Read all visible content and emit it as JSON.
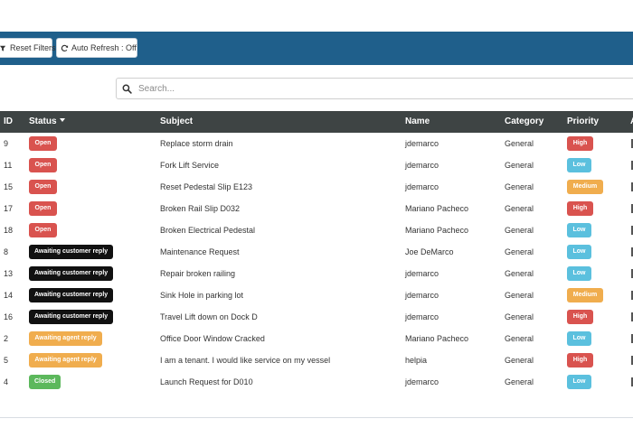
{
  "toolbar": {
    "reset_label": "Reset Filters",
    "auto_refresh_label": "Auto Refresh : Off"
  },
  "search": {
    "placeholder": "Search...",
    "value": ""
  },
  "table": {
    "headers": {
      "id": "ID",
      "status": "Status",
      "subject": "Subject",
      "name": "Name",
      "category": "Category",
      "priority": "Priority"
    },
    "rows": [
      {
        "id": "9",
        "status": "Open",
        "subject": "Replace storm drain",
        "name": "jdemarco",
        "category": "General",
        "priority": "High"
      },
      {
        "id": "11",
        "status": "Open",
        "subject": "Fork Lift Service",
        "name": "jdemarco",
        "category": "General",
        "priority": "Low"
      },
      {
        "id": "15",
        "status": "Open",
        "subject": "Reset Pedestal Slip E123",
        "name": "jdemarco",
        "category": "General",
        "priority": "Medium"
      },
      {
        "id": "17",
        "status": "Open",
        "subject": "Broken Rail Slip D032",
        "name": "Mariano Pacheco",
        "category": "General",
        "priority": "High"
      },
      {
        "id": "18",
        "status": "Open",
        "subject": "Broken Electrical Pedestal",
        "name": "Mariano Pacheco",
        "category": "General",
        "priority": "Low"
      },
      {
        "id": "8",
        "status": "Awaiting customer reply",
        "subject": "Maintenance Request",
        "name": "Joe DeMarco",
        "category": "General",
        "priority": "Low"
      },
      {
        "id": "13",
        "status": "Awaiting customer reply",
        "subject": "Repair broken railing",
        "name": "jdemarco",
        "category": "General",
        "priority": "Low"
      },
      {
        "id": "14",
        "status": "Awaiting customer reply",
        "subject": "Sink Hole in parking lot",
        "name": "jdemarco",
        "category": "General",
        "priority": "Medium"
      },
      {
        "id": "16",
        "status": "Awaiting customer reply",
        "subject": "Travel Lift down on Dock D",
        "name": "jdemarco",
        "category": "General",
        "priority": "High"
      },
      {
        "id": "2",
        "status": "Awaiting agent reply",
        "subject": "Office Door Window Cracked",
        "name": "Mariano Pacheco",
        "category": "General",
        "priority": "Low"
      },
      {
        "id": "5",
        "status": "Awaiting agent reply",
        "subject": "I am a tenant. I would like service on my vessel",
        "name": "helpia",
        "category": "General",
        "priority": "High"
      },
      {
        "id": "4",
        "status": "Closed",
        "subject": "Launch Request for D010",
        "name": "jdemarco",
        "category": "General",
        "priority": "Low"
      }
    ]
  },
  "colors": {
    "toolbar_bg": "#1f5f8b",
    "header_bg": "#3e4444",
    "status_open": "#d9534f",
    "status_awaiting_customer": "#111111",
    "status_awaiting_agent": "#f0ad4e",
    "status_closed": "#5cb85c",
    "priority_high": "#d9534f",
    "priority_low": "#5bc0de",
    "priority_medium": "#f0ad4e"
  },
  "icons": {
    "reset": "filter-reset-icon",
    "auto_refresh": "refresh-icon",
    "search": "search-icon",
    "sort": "caret-down-icon"
  }
}
